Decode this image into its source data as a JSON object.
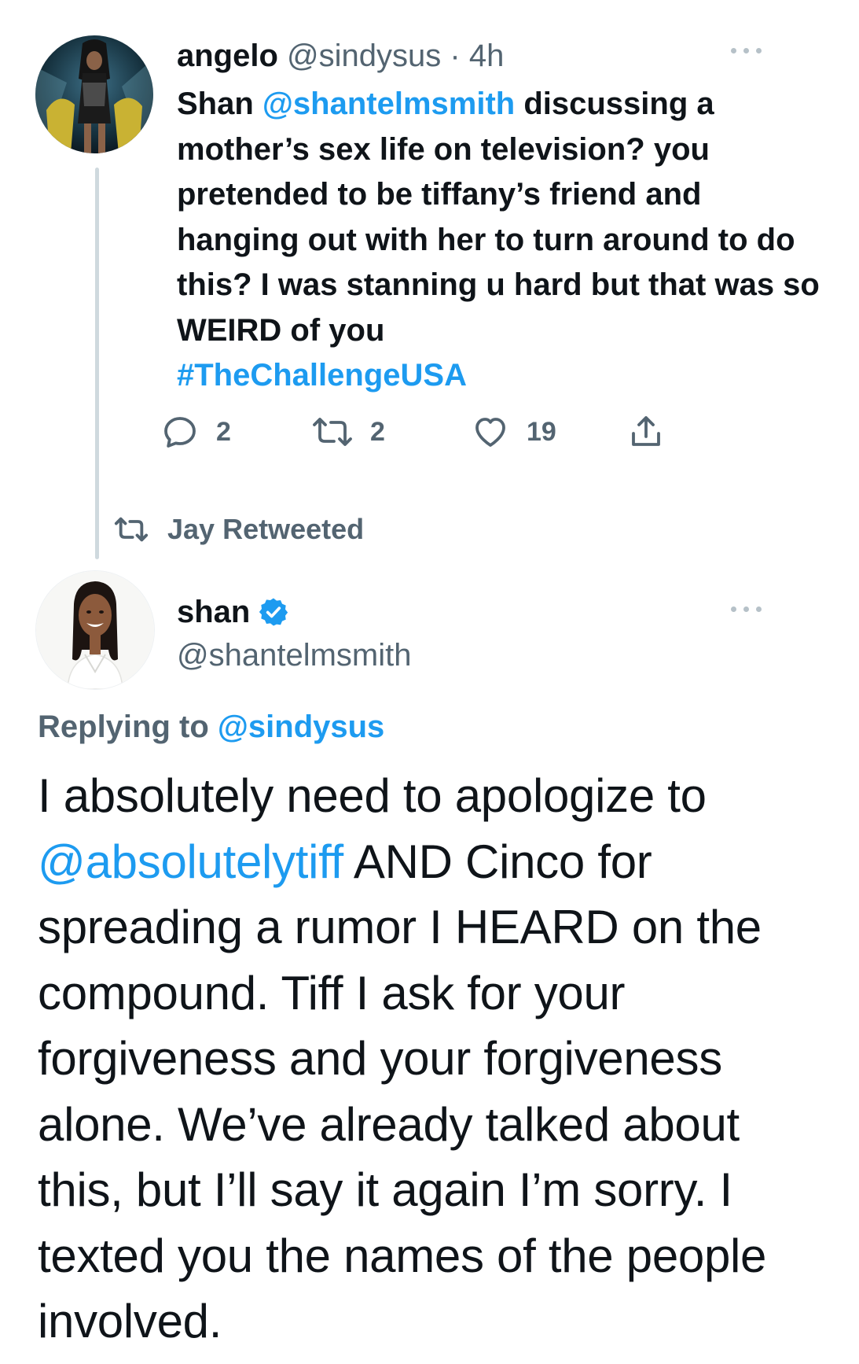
{
  "tweet1": {
    "display_name": "angelo",
    "handle": "@sindysus",
    "separator": "·",
    "time": "4h",
    "text_before_mention": "Shan ",
    "mention": "@shantelmsmith",
    "text_after_mention": " discussing a mother’s sex life on television? you pretended to be tiffany’s friend and hanging out with her to turn around to do this? I was stanning u hard but that was so WEIRD of you",
    "hashtag": "#TheChallengeUSA",
    "actions": {
      "reply_count": "2",
      "retweet_count": "2",
      "like_count": "19"
    }
  },
  "social_context": {
    "text": "Jay Retweeted"
  },
  "tweet2": {
    "display_name": "shan",
    "handle": "@shantelmsmith",
    "replying_prefix": "Replying to ",
    "replying_to": "@sindysus",
    "text_before_mention": "I absolutely need to apologize to ",
    "mention": "@absolutelytiff",
    "text_after_mention": " AND Cinco for spreading a rumor I HEARD on the compound. Tiff I ask for your forgiveness and your forgiveness alone. We’ve already talked about this, but I’ll say it again I’m sorry. I texted you the names of the people involved."
  },
  "icons": {
    "reply": "reply-icon",
    "retweet": "retweet-icon",
    "like": "heart-icon",
    "share": "share-icon",
    "verified": "verified-badge-icon",
    "more": "more-options-icon"
  },
  "colors": {
    "link": "#1d9bf0",
    "secondary_text": "#536471",
    "primary_text": "#0f1419",
    "thread_line": "#cfd9de"
  }
}
